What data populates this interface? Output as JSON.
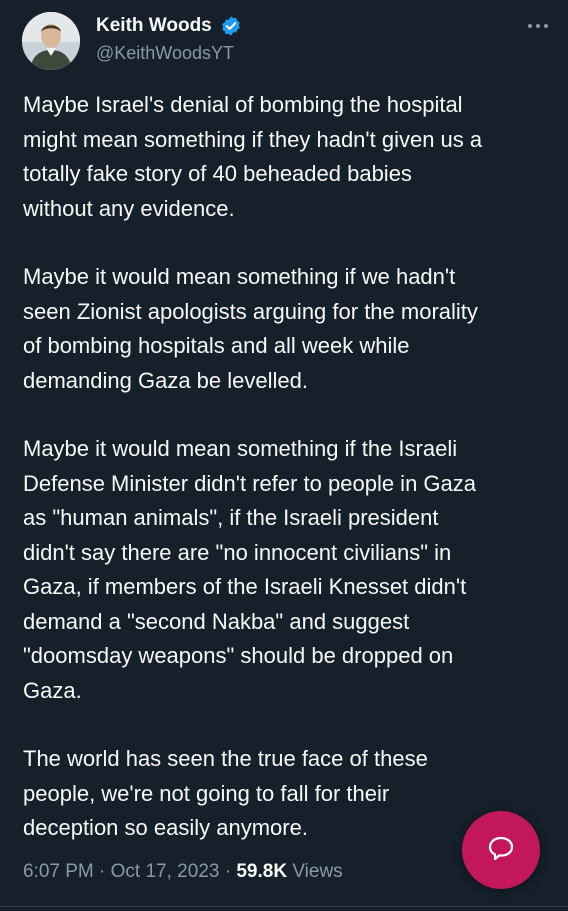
{
  "author": {
    "display_name": "Keith Woods",
    "handle": "@KeithWoodsYT",
    "verified": true,
    "verified_color": "#1d9bf0"
  },
  "tweet": {
    "paragraphs": [
      "Maybe Israel's denial of bombing the hospital\nmight mean something if they hadn't given us a\ntotally fake story of 40 beheaded babies\nwithout any evidence.",
      "Maybe it would mean something if we hadn't\nseen Zionist apologists arguing for the morality\nof bombing hospitals and all week while\ndemanding Gaza be levelled.",
      "Maybe it would mean something if the Israeli\nDefense Minister didn't refer to people in Gaza\nas \"human animals\", if the Israeli president\ndidn't say there are \"no innocent civilians\" in\nGaza, if members of the Israeli Knesset didn't\ndemand a \"second Nakba\" and suggest\n\"doomsday weapons\" should be dropped on\nGaza.",
      "The world has seen the true face of these\npeople, we're not going to fall for their\ndeception so easily anymore."
    ]
  },
  "meta": {
    "time": "6:07 PM",
    "sep1": " · ",
    "date": "Oct 17, 2023",
    "sep2": " · ",
    "views_count": "59.8K",
    "views_label": " Views"
  },
  "icons": {
    "more": "more-horizontal-icon",
    "verified": "verified-badge-icon",
    "fab": "compose-reply-icon"
  },
  "colors": {
    "background": "#15202b",
    "text": "#f7f9f9",
    "secondary": "#8b98a5",
    "fab": "#c2185b"
  }
}
